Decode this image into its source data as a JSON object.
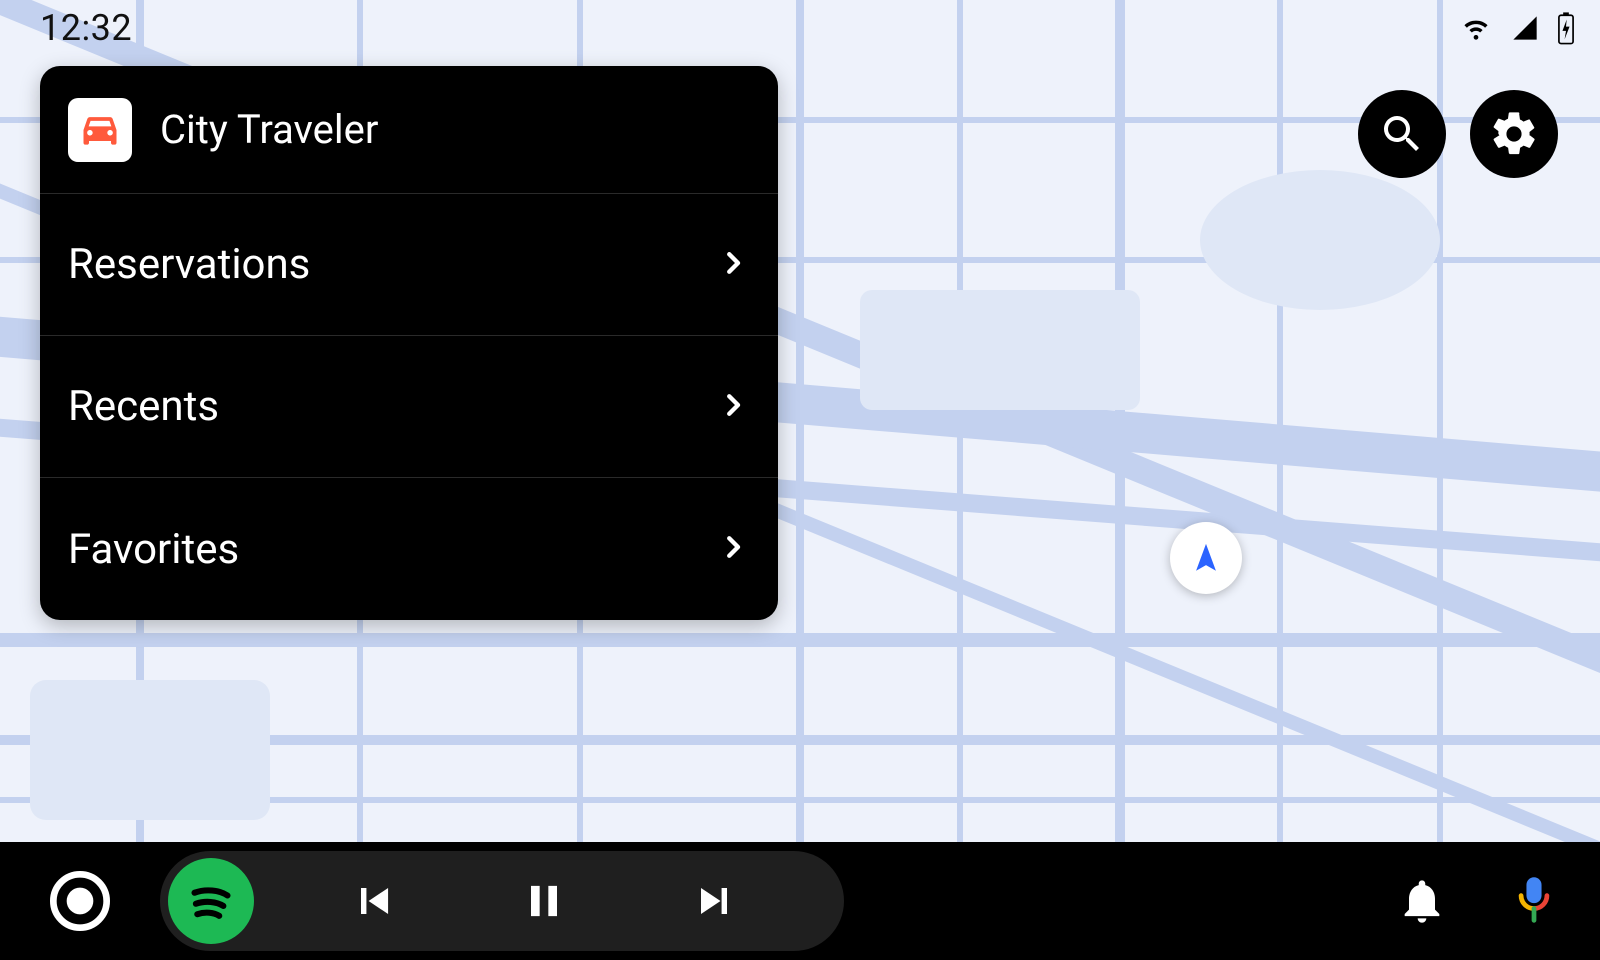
{
  "status_bar": {
    "time": "12:32",
    "wifi_icon": "wifi",
    "signal_icon": "cellular",
    "battery_icon": "battery-charging"
  },
  "panel": {
    "app_title": "City Traveler",
    "app_icon": "car",
    "items": [
      {
        "label": "Reservations"
      },
      {
        "label": "Recents"
      },
      {
        "label": "Favorites"
      }
    ]
  },
  "floating_actions": {
    "search_icon": "search",
    "settings_icon": "settings"
  },
  "map": {
    "location_marker_icon": "navigation-arrow"
  },
  "bottom_bar": {
    "home_icon": "circle",
    "media_app_icon": "spotify",
    "prev_icon": "skip-previous",
    "play_pause_icon": "pause",
    "next_icon": "skip-next",
    "notifications_icon": "bell",
    "assistant_icon": "google-mic"
  },
  "colors": {
    "accent_app_icon": "#ff5a3c",
    "spotify_green": "#1db954",
    "marker_blue": "#2b63ff",
    "mic_yellow": "#f4b400",
    "mic_blue": "#4285f4",
    "mic_red": "#ea4335",
    "mic_green": "#34a853"
  }
}
